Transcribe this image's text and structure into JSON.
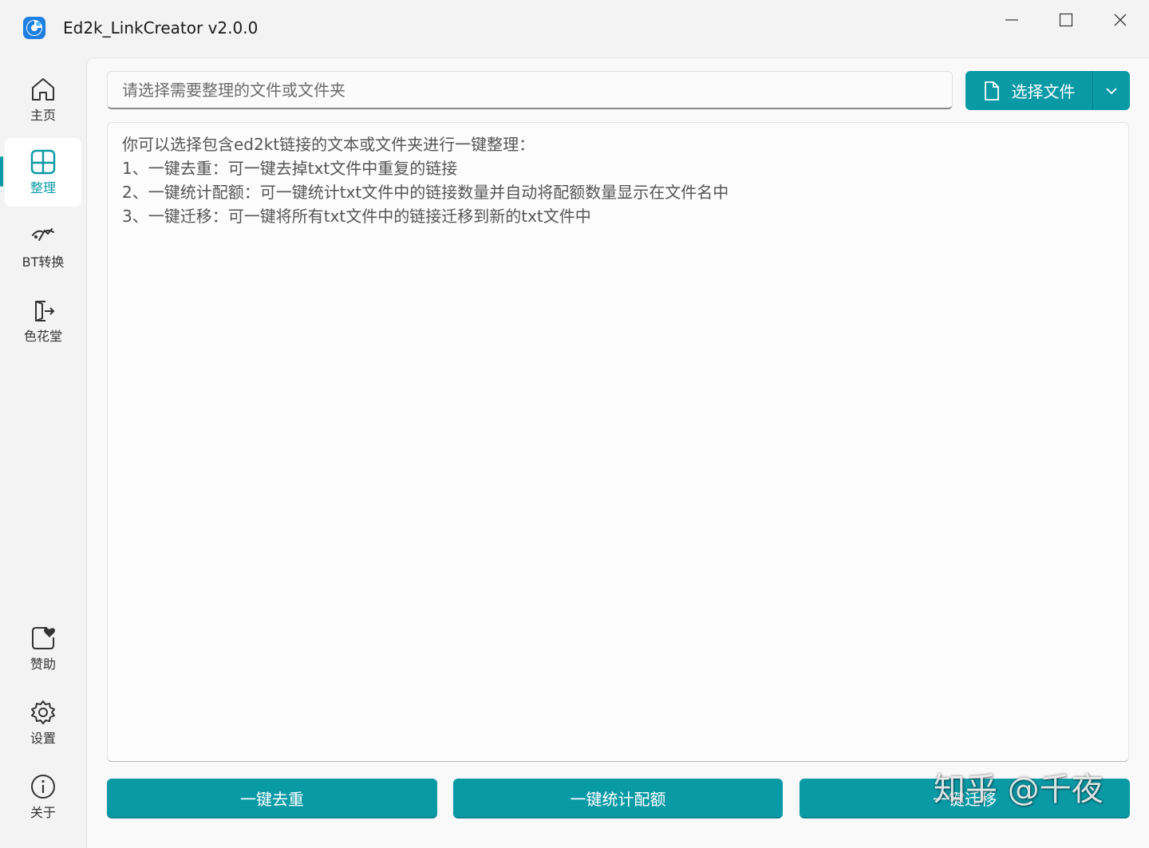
{
  "window": {
    "title": "Ed2k_LinkCreator v2.0.0",
    "icon": "app-logo-icon"
  },
  "sidebar": {
    "items": [
      {
        "label": "主页",
        "icon": "home-icon",
        "active": false
      },
      {
        "label": "整理",
        "icon": "grid-layout-icon",
        "active": true
      },
      {
        "label": "BT转换",
        "icon": "magnet-icon",
        "active": false
      },
      {
        "label": "色花堂",
        "icon": "exit-door-icon",
        "active": false
      }
    ],
    "bottom_items": [
      {
        "label": "赞助",
        "icon": "heart-icon"
      },
      {
        "label": "设置",
        "icon": "gear-icon"
      },
      {
        "label": "关于",
        "icon": "info-icon"
      }
    ]
  },
  "main": {
    "path_input": {
      "value": "",
      "placeholder": "请选择需要整理的文件或文件夹"
    },
    "select_button": {
      "label": "选择文件",
      "icon": "document-icon",
      "dropdown_icon": "chevron-down-icon"
    },
    "description_lines": [
      "你可以选择包含ed2kt链接的文本或文件夹进行一键整理：",
      "1、一键去重：可一键去掉txt文件中重复的链接",
      "2、一键统计配额：可一键统计txt文件中的链接数量并自动将配额数量显示在文件名中",
      "3、一键迁移：可一键将所有txt文件中的链接迁移到新的txt文件中"
    ],
    "actions": {
      "dedup_label": "一键去重",
      "count_label": "一键统计配额",
      "migrate_label": "一键迁移"
    }
  },
  "watermark": "知乎 @千夜",
  "colors": {
    "accent": "#0a9aa6",
    "background": "#f3f3f3",
    "panel": "#f9f9f9"
  }
}
